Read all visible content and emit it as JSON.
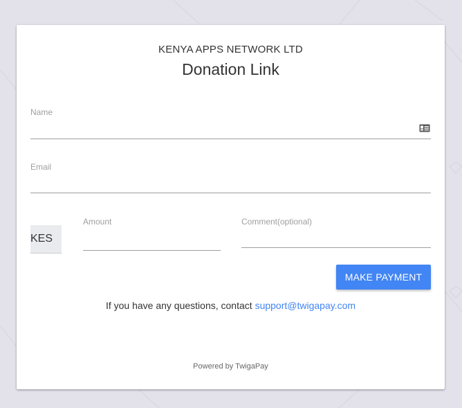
{
  "header": {
    "company": "KENYA APPS NETWORK LTD",
    "title": "Donation Link"
  },
  "form": {
    "name_label": "Name",
    "name_value": "",
    "name_icon": "id-card-icon",
    "email_label": "Email",
    "email_value": "",
    "currency": "KES",
    "amount_label": "Amount",
    "amount_value": "",
    "comment_label": "Comment(optional)",
    "comment_value": "",
    "submit_label": "MAKE PAYMENT"
  },
  "contact": {
    "text": "If you have any questions, contact",
    "email": "support@twigapay.com"
  },
  "footer": {
    "powered_by": "Powered by TwigaPay"
  },
  "colors": {
    "accent": "#4285f4",
    "background": "#e3e1ea",
    "card": "#ffffff"
  }
}
